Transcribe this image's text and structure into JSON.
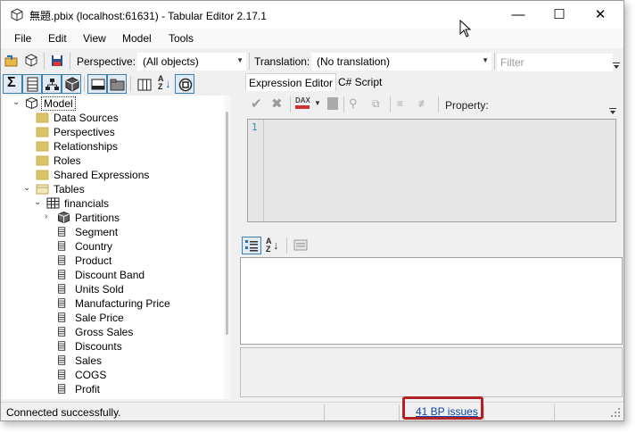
{
  "window": {
    "title": "無題.pbix (localhost:61631) - Tabular Editor 2.17.1",
    "controls": {
      "minimize": "—",
      "maximize": "☐",
      "close": "✕"
    }
  },
  "menu": [
    "File",
    "Edit",
    "View",
    "Model",
    "Tools"
  ],
  "toolbar": {
    "perspective_label": "Perspective:",
    "perspective_value": "(All objects)",
    "translation_label": "Translation:",
    "translation_value": "(No translation)",
    "filter_placeholder": "Filter"
  },
  "tree": {
    "root": "Model",
    "folders": [
      "Data Sources",
      "Perspectives",
      "Relationships",
      "Roles",
      "Shared Expressions"
    ],
    "tables_label": "Tables",
    "table_name": "financials",
    "partitions_label": "Partitions",
    "columns": [
      "Segment",
      "Country",
      "Product",
      "Discount Band",
      "Units Sold",
      "Manufacturing Price",
      "Sale Price",
      "Gross Sales",
      "Discounts",
      " Sales",
      "COGS",
      "Profit"
    ]
  },
  "tabs": [
    "Expression Editor",
    "C# Script"
  ],
  "editor": {
    "property_label": "Property:",
    "line_number": "1",
    "dax_label": "DAX"
  },
  "status": {
    "message": "Connected successfully.",
    "bp_issues": "41 BP issues"
  },
  "colors": {
    "highlight_box": "#b22222",
    "link": "#0645ad",
    "folder": "#d9c46a",
    "selected_border": "#3c7fb1"
  },
  "icons": {
    "app": "cube-icon",
    "folder": "folder-icon",
    "table": "table-icon",
    "column": "column-icon",
    "partition": "partition-icon"
  }
}
